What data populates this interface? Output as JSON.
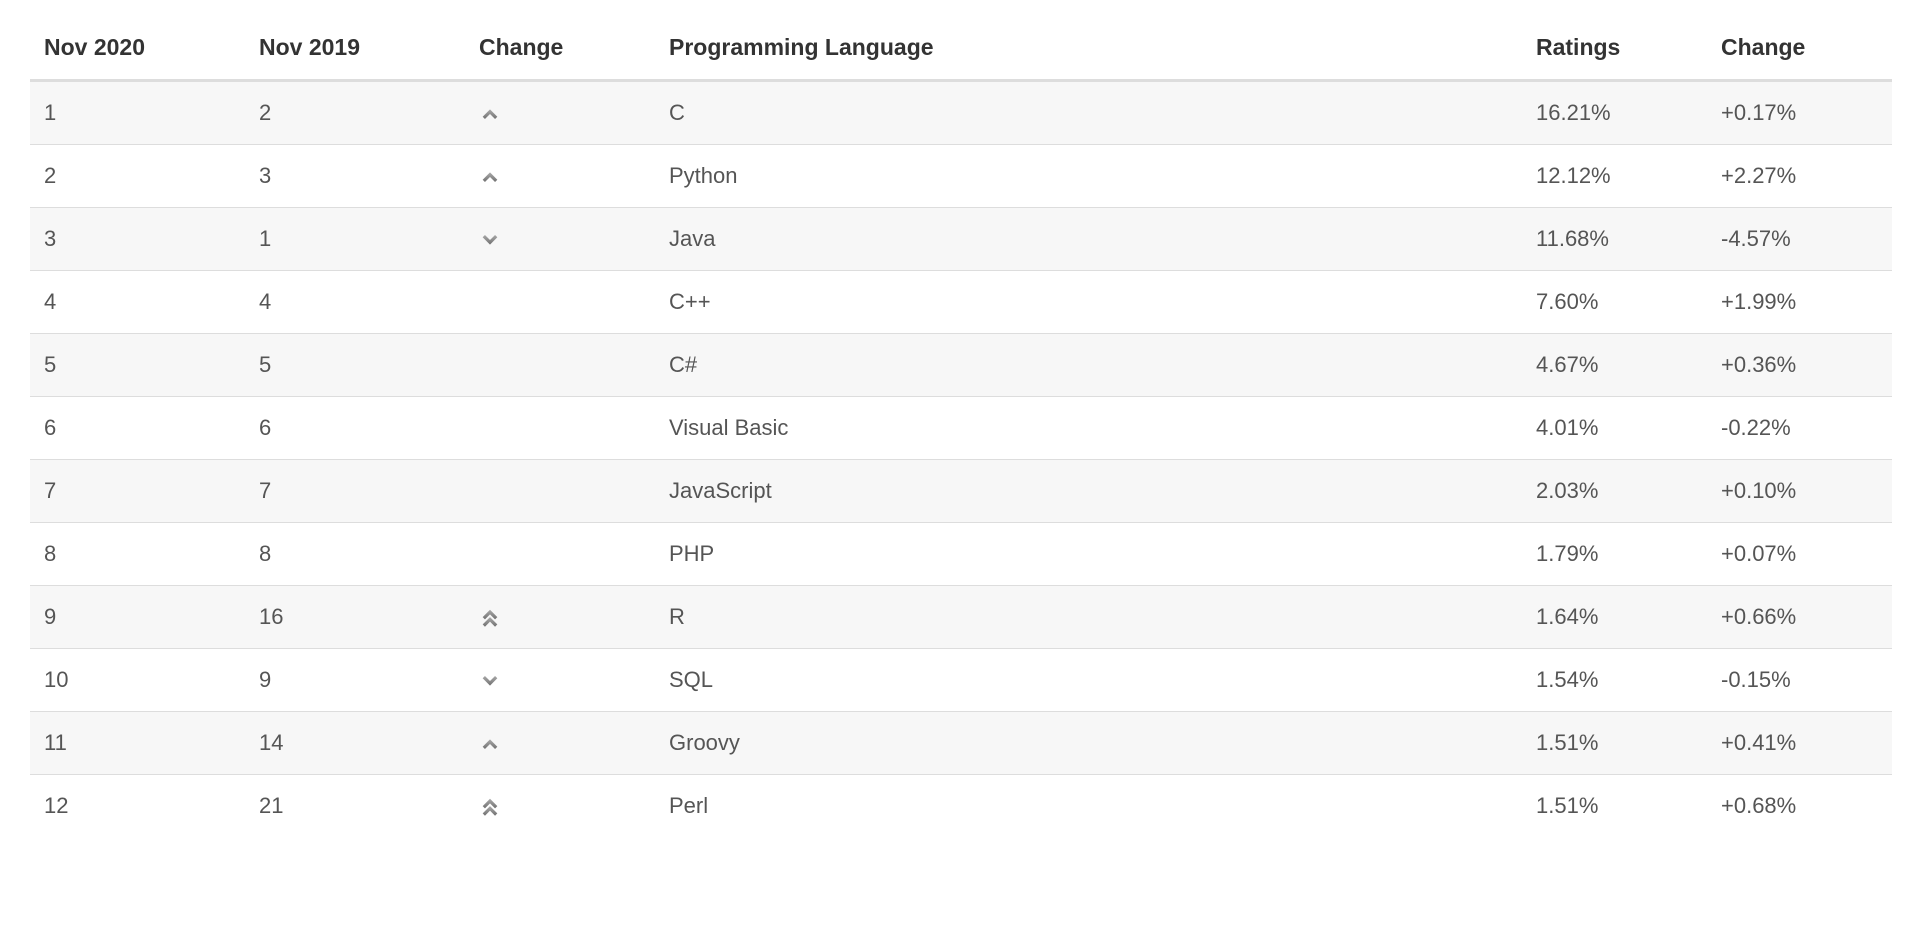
{
  "headers": {
    "nov2020": "Nov 2020",
    "nov2019": "Nov 2019",
    "trend": "Change",
    "language": "Programming Language",
    "ratings": "Ratings",
    "delta": "Change"
  },
  "rows": [
    {
      "now": "1",
      "prev": "2",
      "trend": "up",
      "language": "C",
      "ratings": "16.21%",
      "delta": "+0.17%"
    },
    {
      "now": "2",
      "prev": "3",
      "trend": "up",
      "language": "Python",
      "ratings": "12.12%",
      "delta": "+2.27%"
    },
    {
      "now": "3",
      "prev": "1",
      "trend": "down",
      "language": "Java",
      "ratings": "11.68%",
      "delta": "-4.57%"
    },
    {
      "now": "4",
      "prev": "4",
      "trend": "",
      "language": "C++",
      "ratings": "7.60%",
      "delta": "+1.99%"
    },
    {
      "now": "5",
      "prev": "5",
      "trend": "",
      "language": "C#",
      "ratings": "4.67%",
      "delta": "+0.36%"
    },
    {
      "now": "6",
      "prev": "6",
      "trend": "",
      "language": "Visual Basic",
      "ratings": "4.01%",
      "delta": "-0.22%"
    },
    {
      "now": "7",
      "prev": "7",
      "trend": "",
      "language": "JavaScript",
      "ratings": "2.03%",
      "delta": "+0.10%"
    },
    {
      "now": "8",
      "prev": "8",
      "trend": "",
      "language": "PHP",
      "ratings": "1.79%",
      "delta": "+0.07%"
    },
    {
      "now": "9",
      "prev": "16",
      "trend": "double-up",
      "language": "R",
      "ratings": "1.64%",
      "delta": "+0.66%"
    },
    {
      "now": "10",
      "prev": "9",
      "trend": "down",
      "language": "SQL",
      "ratings": "1.54%",
      "delta": "-0.15%"
    },
    {
      "now": "11",
      "prev": "14",
      "trend": "up",
      "language": "Groovy",
      "ratings": "1.51%",
      "delta": "+0.41%"
    },
    {
      "now": "12",
      "prev": "21",
      "trend": "double-up",
      "language": "Perl",
      "ratings": "1.51%",
      "delta": "+0.68%"
    }
  ]
}
